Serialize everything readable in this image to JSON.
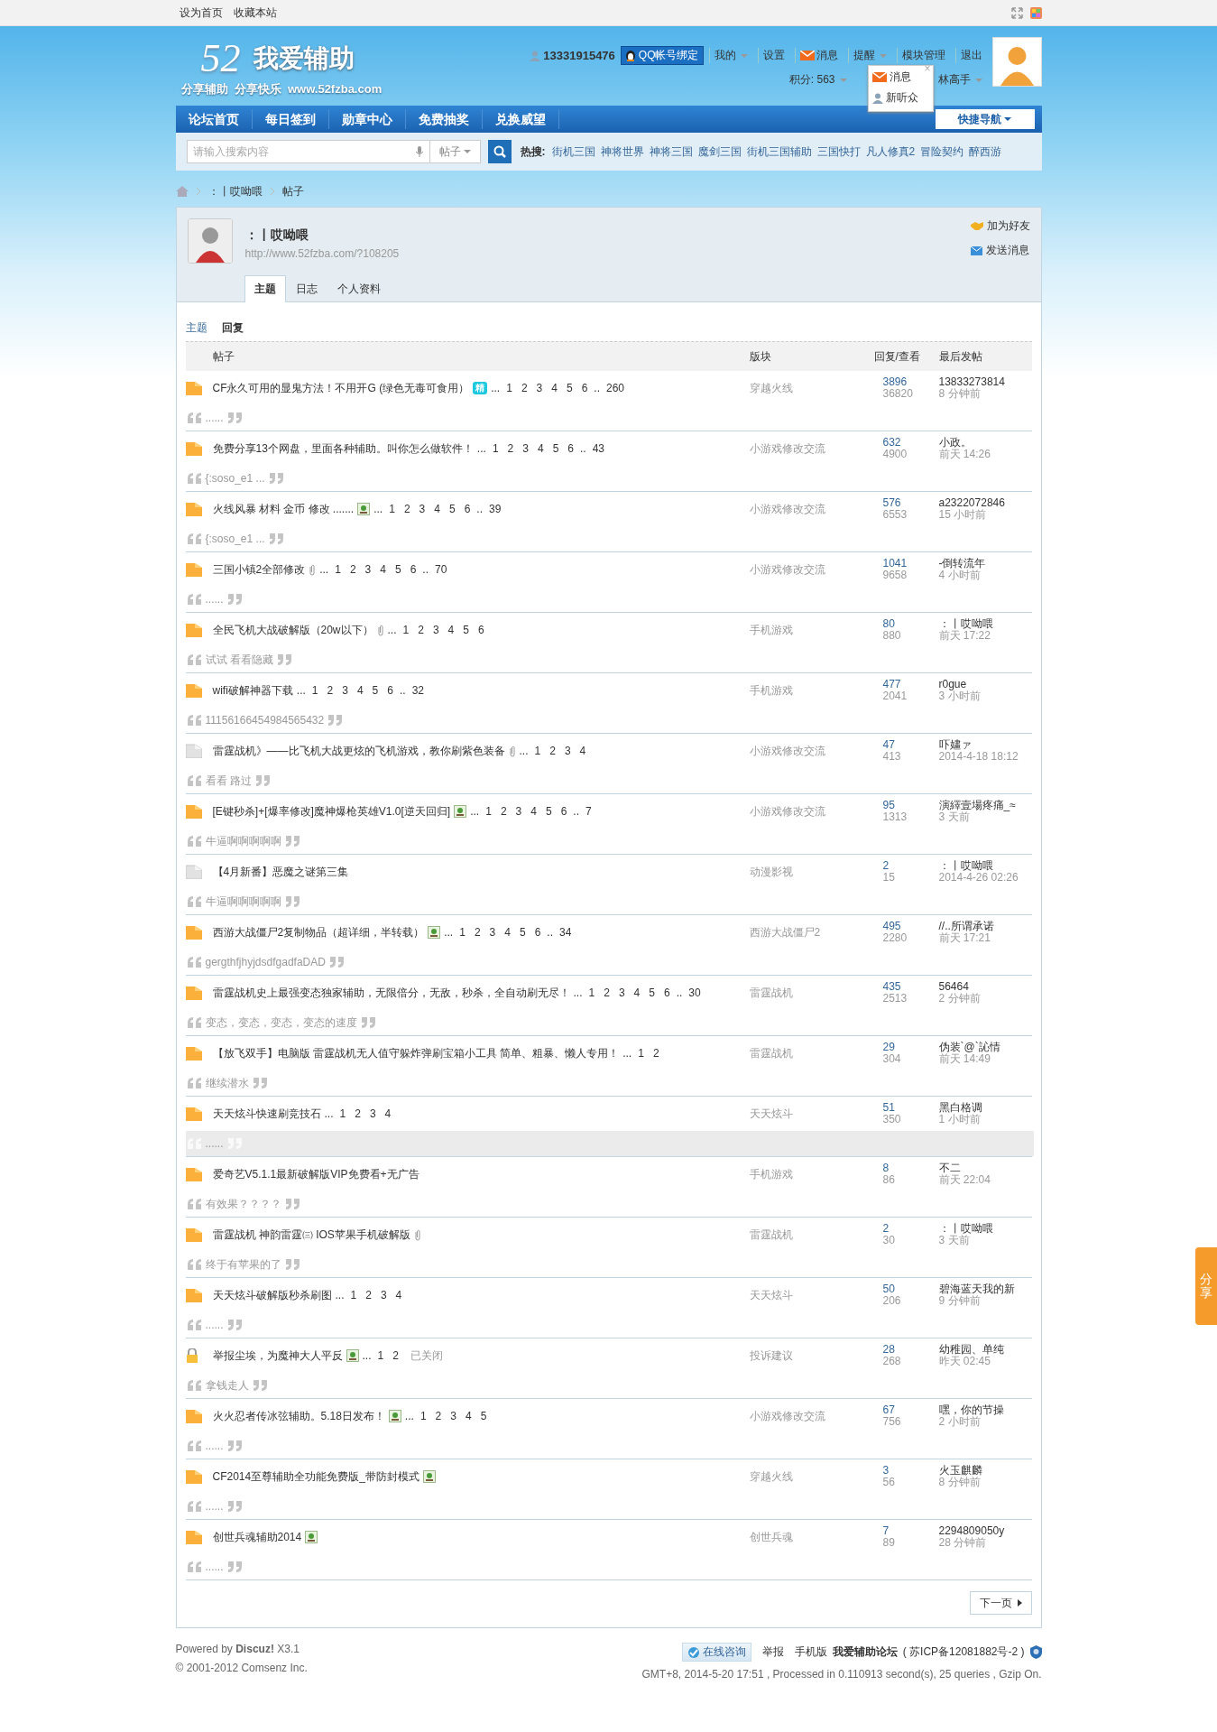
{
  "topbar": {
    "links": [
      "设为首页",
      "收藏本站"
    ]
  },
  "header": {
    "logo": {
      "number": "52",
      "name": "我爱辅助",
      "tagline": "分享辅助  分享快乐  www.52fzba.com"
    },
    "username": "13331915476",
    "qq_button": "QQ帐号绑定",
    "links": [
      {
        "label": "我的",
        "kind": "menu"
      },
      {
        "label": "设置",
        "kind": "plain"
      },
      {
        "label": "消息",
        "kind": "mail"
      },
      {
        "label": "提醒",
        "kind": "menu"
      },
      {
        "label": "模块管理",
        "kind": "plain"
      },
      {
        "label": "退出",
        "kind": "plain"
      }
    ],
    "points": "积分: 563",
    "group": "林高手",
    "popup": {
      "close": "×",
      "items": [
        {
          "kind": "mail",
          "label": "消息"
        },
        {
          "kind": "person",
          "label": "新听众"
        }
      ]
    }
  },
  "nav": {
    "items": [
      "论坛首页",
      "每日签到",
      "勋章中心",
      "免费抽奖",
      "兑换威望"
    ],
    "quick_nav": "快捷导航"
  },
  "search": {
    "placeholder": "请输入搜索内容",
    "type": "帖子",
    "hot_label": "热搜:",
    "hot": [
      "街机三国",
      "神将世界",
      "神将三国",
      "魔剑三国",
      "街机三国辅助",
      "三国快打",
      "凡人修真2",
      "冒险契约",
      "醉西游"
    ]
  },
  "breadcrumb": [
    "：丨哎呦喂",
    "帖子"
  ],
  "profile": {
    "name": "：丨哎呦喂",
    "url": "http://www.52fzba.com/?108205",
    "actions": [
      {
        "kind": "friend",
        "label": "加为好友"
      },
      {
        "kind": "message",
        "label": "发送消息"
      }
    ],
    "tabs": [
      {
        "label": "主题",
        "selected": true
      },
      {
        "label": "日志",
        "selected": false
      },
      {
        "label": "个人资料",
        "selected": false
      }
    ]
  },
  "subtabs": [
    {
      "label": "主题",
      "selected": false
    },
    {
      "label": "回复",
      "selected": true
    }
  ],
  "columns": [
    "帖子",
    "版块",
    "回复/查看",
    "最后发帖"
  ],
  "rows": [
    {
      "kind": "folder",
      "title": "CF永久可用的显鬼方法！不用开G (绿色无毒可食用）",
      "extras": [
        {
          "kind": "digest",
          "label": "精"
        }
      ],
      "pages": [
        "...",
        "1",
        "2",
        "3",
        "4",
        "5",
        "6",
        "..",
        "260"
      ],
      "forum": "穿越火线",
      "replies": "3896",
      "views": "36820",
      "last_user": "13833273814",
      "last_time": "8 分钟前",
      "quote": "......",
      "highlighted": false
    },
    {
      "kind": "folder",
      "title": "免费分享13个网盘，里面各种辅助。叫你怎么做软件！",
      "extras": [],
      "pages": [
        "...",
        "1",
        "2",
        "3",
        "4",
        "5",
        "6",
        "..",
        "43"
      ],
      "forum": "小游戏修改交流",
      "replies": "632",
      "views": "4900",
      "last_user": "小政。",
      "last_time": "前天 14:26",
      "quote": "{:soso_e1 ...",
      "highlighted": false
    },
    {
      "kind": "folder",
      "title": "火线风暴 材料 金币 修改 .......",
      "extras": [
        {
          "kind": "image"
        }
      ],
      "pages": [
        "...",
        "1",
        "2",
        "3",
        "4",
        "5",
        "6",
        "..",
        "39"
      ],
      "forum": "小游戏修改交流",
      "replies": "576",
      "views": "6553",
      "last_user": "a2322072846",
      "last_time": "15 小时前",
      "quote": "{:soso_e1 ...",
      "highlighted": false
    },
    {
      "kind": "folder",
      "title": "三国小镇2全部修改",
      "extras": [
        {
          "kind": "attachment"
        }
      ],
      "pages": [
        "...",
        "1",
        "2",
        "3",
        "4",
        "5",
        "6",
        "..",
        "70"
      ],
      "forum": "小游戏修改交流",
      "replies": "1041",
      "views": "9658",
      "last_user": "-倒转流年",
      "last_time": "4 小时前",
      "quote": "......",
      "highlighted": false
    },
    {
      "kind": "folder",
      "title": "全民飞机大战破解版（20w以下）",
      "extras": [
        {
          "kind": "attachment"
        }
      ],
      "pages": [
        "...",
        "1",
        "2",
        "3",
        "4",
        "5",
        "6"
      ],
      "forum": "手机游戏",
      "replies": "80",
      "views": "880",
      "last_user": "：丨哎呦喂",
      "last_time": "前天 17:22",
      "quote": "试试 看看隐藏",
      "highlighted": false
    },
    {
      "kind": "folder",
      "title": "wifi破解神器下载",
      "extras": [],
      "pages": [
        "...",
        "1",
        "2",
        "3",
        "4",
        "5",
        "6",
        "..",
        "32"
      ],
      "forum": "手机游戏",
      "replies": "477",
      "views": "2041",
      "last_user": "r0gue",
      "last_time": "3 小时前",
      "quote": "11156166454984565432",
      "highlighted": false
    },
    {
      "kind": "plain",
      "title": "雷霆战机》——比飞机大战更炫的飞机游戏，教你刷紫色装备",
      "extras": [
        {
          "kind": "attachment"
        }
      ],
      "pages": [
        "...",
        "1",
        "2",
        "3",
        "4"
      ],
      "forum": "小游戏修改交流",
      "replies": "47",
      "views": "413",
      "last_user": "吓嫿ァ",
      "last_time": "2014-4-18 18:12",
      "quote": "看看 路过",
      "highlighted": false
    },
    {
      "kind": "folder",
      "title": "[E键秒杀]+[爆率修改]魔神爆枪英雄V1.0[逆天回归]",
      "extras": [
        {
          "kind": "image"
        }
      ],
      "pages": [
        "...",
        "1",
        "2",
        "3",
        "4",
        "5",
        "6",
        "..",
        "7"
      ],
      "forum": "小游戏修改交流",
      "replies": "95",
      "views": "1313",
      "last_user": "演繹壹場疼痛_≈",
      "last_time": "3 天前",
      "quote": "牛逼啊啊啊啊啊",
      "highlighted": false
    },
    {
      "kind": "plain",
      "title": "【4月新番】恶魔之谜第三集",
      "extras": [],
      "pages": [],
      "forum": "动漫影视",
      "replies": "2",
      "views": "15",
      "last_user": "：丨哎呦喂",
      "last_time": "2014-4-26 02:26",
      "quote": "牛逼啊啊啊啊啊",
      "highlighted": false
    },
    {
      "kind": "folder",
      "title": "西游大战僵尸2复制物品（超详细，半转载）",
      "extras": [
        {
          "kind": "image"
        }
      ],
      "pages": [
        "...",
        "1",
        "2",
        "3",
        "4",
        "5",
        "6",
        "..",
        "34"
      ],
      "forum": "西游大战僵尸2",
      "replies": "495",
      "views": "2280",
      "last_user": "//..所谓承诺",
      "last_time": "前天 17:21",
      "quote": "gergthfjhyjdsdfgadfaDAD",
      "highlighted": false
    },
    {
      "kind": "folder",
      "title": "雷霆战机史上最强变态独家辅助，无限倍分，无敌，秒杀，全自动刷无尽！",
      "extras": [],
      "pages": [
        "...",
        "1",
        "2",
        "3",
        "4",
        "5",
        "6",
        "..",
        "30"
      ],
      "forum": "雷霆战机",
      "replies": "435",
      "views": "2513",
      "last_user": "56464",
      "last_time": "2 分钟前",
      "quote": "变态，变态，变态，变态的速度",
      "highlighted": false
    },
    {
      "kind": "folder",
      "title": "【放飞双手】电脑版 雷霆战机无人值守躲炸弹刷宝箱小工具 简单、粗暴、懒人专用！",
      "extras": [],
      "pages": [
        "...",
        "1",
        "2"
      ],
      "forum": "雷霆战机",
      "replies": "29",
      "views": "304",
      "last_user": "伪装`@`訫情",
      "last_time": "前天 14:49",
      "quote": "继续潜水",
      "highlighted": false
    },
    {
      "kind": "folder",
      "title": "天天炫斗快速刷竞技石",
      "extras": [],
      "pages": [
        "...",
        "1",
        "2",
        "3",
        "4"
      ],
      "forum": "天天炫斗",
      "replies": "51",
      "views": "350",
      "last_user": "黑白格调",
      "last_time": "1 小时前",
      "quote": "......",
      "highlighted": true
    },
    {
      "kind": "folder",
      "title": "爱奇艺V5.1.1最新破解版VIP免费看+无广告",
      "extras": [],
      "pages": [],
      "forum": "手机游戏",
      "replies": "8",
      "views": "86",
      "last_user": "不二",
      "last_time": "前天 22:04",
      "quote": "有效果？？？？",
      "highlighted": false
    },
    {
      "kind": "folder",
      "title": "雷霆战机 神韵雷霆㈢ IOS苹果手机破解版",
      "extras": [
        {
          "kind": "attachment"
        }
      ],
      "pages": [],
      "forum": "雷霆战机",
      "replies": "2",
      "views": "30",
      "last_user": "：丨哎呦喂",
      "last_time": "3 天前",
      "quote": "终于有苹果的了",
      "highlighted": false
    },
    {
      "kind": "folder",
      "title": "天天炫斗破解版秒杀刷图",
      "extras": [],
      "pages": [
        "...",
        "1",
        "2",
        "3",
        "4"
      ],
      "forum": "天天炫斗",
      "replies": "50",
      "views": "206",
      "last_user": "碧海蓝天我的新",
      "last_time": "9 分钟前",
      "quote": "......",
      "highlighted": false
    },
    {
      "kind": "lock",
      "title": "举报尘埃，为魔神大人平反",
      "extras": [
        {
          "kind": "image"
        }
      ],
      "pages": [
        "...",
        "1",
        "2"
      ],
      "closed": "已关闭",
      "forum": "投诉建议",
      "replies": "28",
      "views": "268",
      "last_user": "幼稚园、单纯",
      "last_time": "昨天 02:45",
      "quote": "拿钱走人",
      "highlighted": false
    },
    {
      "kind": "folder",
      "title": "火火忍者传冰弦辅助。5.18日发布！",
      "extras": [
        {
          "kind": "image"
        }
      ],
      "pages": [
        "...",
        "1",
        "2",
        "3",
        "4",
        "5"
      ],
      "forum": "小游戏修改交流",
      "replies": "67",
      "views": "756",
      "last_user": "嘿，你的节操",
      "last_time": "2 小时前",
      "quote": "......",
      "highlighted": false
    },
    {
      "kind": "folder",
      "title": "CF2014至尊辅助全功能免费版_带防封模式",
      "extras": [
        {
          "kind": "image"
        }
      ],
      "pages": [],
      "forum": "穿越火线",
      "replies": "3",
      "views": "56",
      "last_user": "火玉麒麟",
      "last_time": "8 分钟前",
      "quote": "......",
      "highlighted": false
    },
    {
      "kind": "folder",
      "title": "创世兵魂辅助2014",
      "extras": [
        {
          "kind": "image"
        }
      ],
      "pages": [],
      "forum": "创世兵魂",
      "replies": "7",
      "views": "89",
      "last_user": "2294809050y",
      "last_time": "28 分钟前",
      "quote": "......",
      "highlighted": false
    }
  ],
  "pager": {
    "next": "下一页"
  },
  "footer": {
    "powered": "Powered by **Discuz!** X3.1",
    "copyright": "© 2001-2012 Comsenz Inc.",
    "consult": "在线咨询",
    "links": [
      "举报",
      "手机版"
    ],
    "site": "我爱辅助论坛",
    "icp": "( 苏ICP备12081882号-2 )",
    "stats": "GMT+8, 2014-5-20 17:51 , Processed in 0.110913 second(s), 25 queries , Gzip On."
  },
  "side_tab": "分享"
}
